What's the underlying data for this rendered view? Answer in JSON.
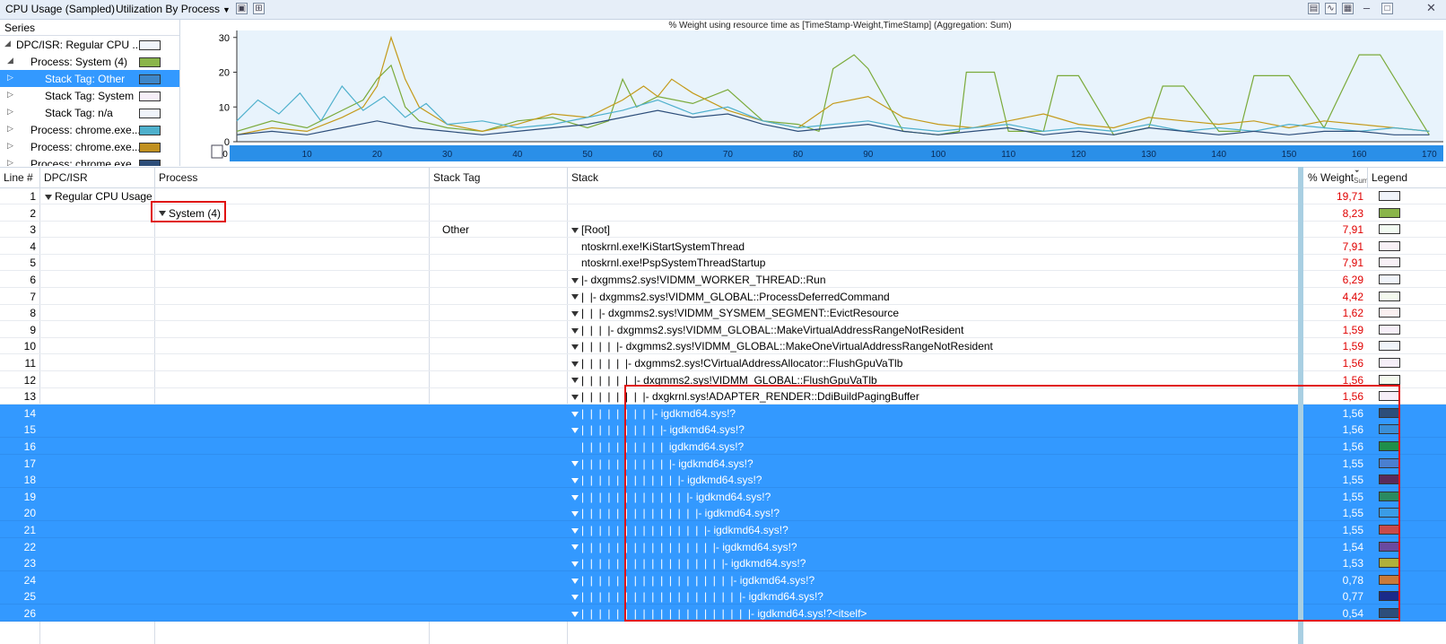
{
  "titlebar": {
    "title": "CPU Usage (Sampled)",
    "preset": "Utilization By Process",
    "icons": [
      "graph-only-icon",
      "graph-table-icon",
      "table-only-icon",
      "minimize-icon",
      "close-icon"
    ]
  },
  "series": {
    "header": "Series",
    "items": [
      {
        "label": "DPC/ISR: Regular CPU ...",
        "expander": "expanded",
        "indent": 0,
        "color": "#f0f4fa",
        "selected": false
      },
      {
        "label": "Process: System (4)",
        "expander": "expanded",
        "indent": 1,
        "color": "#8ab54a",
        "selected": false
      },
      {
        "label": "Stack Tag: Other",
        "expander": "collapsed",
        "indent": 2,
        "color": "#3e86c8",
        "selected": true
      },
      {
        "label": "Stack Tag: System",
        "expander": "collapsed",
        "indent": 2,
        "color": "#f6eef8",
        "selected": false
      },
      {
        "label": "Stack Tag: n/a",
        "expander": "collapsed",
        "indent": 2,
        "color": "#f0f4fa",
        "selected": false
      },
      {
        "label": "Process: chrome.exe...",
        "expander": "collapsed",
        "indent": 1,
        "color": "#4eb0cc",
        "selected": false
      },
      {
        "label": "Process: chrome.exe...",
        "expander": "collapsed",
        "indent": 1,
        "color": "#c09020",
        "selected": false
      },
      {
        "label": "Process: chrome.exe",
        "expander": "collapsed",
        "indent": 1,
        "color": "#2d4e7a",
        "selected": false
      }
    ]
  },
  "chart_data": {
    "type": "line",
    "title": "% Weight using resource time as [TimeStamp-Weight,TimeStamp] (Aggregation: Sum)",
    "xlim": [
      0,
      172
    ],
    "ylim": [
      0,
      32
    ],
    "xticks": [
      "0",
      "10",
      "20",
      "30",
      "40",
      "50",
      "60",
      "70",
      "80",
      "90",
      "100",
      "110",
      "120",
      "130",
      "140",
      "150",
      "160",
      "170"
    ],
    "yticks": [
      "0",
      "10",
      "20",
      "30"
    ],
    "grid": false,
    "series": [
      {
        "color": "#7aaa3a",
        "x": [
          0,
          5,
          10,
          15,
          18,
          20,
          22,
          24,
          26,
          30,
          35,
          40,
          45,
          50,
          53,
          55,
          57,
          60,
          65,
          70,
          75,
          80,
          83,
          85,
          88,
          90,
          95,
          100,
          103,
          104,
          108,
          110,
          115,
          117,
          120,
          125,
          130,
          132,
          135,
          140,
          143,
          145,
          150,
          155,
          160,
          161,
          163,
          170
        ],
        "y": [
          3,
          6,
          4,
          9,
          12,
          18,
          22,
          10,
          6,
          4,
          3,
          6,
          7,
          4,
          6,
          18,
          10,
          13,
          11,
          15,
          6,
          5,
          3,
          21,
          25,
          21,
          3,
          2,
          3,
          20,
          20,
          3,
          3,
          19,
          19,
          2,
          4,
          16,
          16,
          3,
          3,
          19,
          19,
          4,
          25,
          25,
          25,
          2
        ]
      },
      {
        "color": "#c49a1a",
        "x": [
          0,
          5,
          10,
          15,
          18,
          20,
          22,
          23,
          24,
          26,
          30,
          35,
          40,
          45,
          50,
          55,
          58,
          60,
          62,
          65,
          70,
          75,
          80,
          85,
          90,
          95,
          100,
          105,
          110,
          115,
          120,
          125,
          130,
          135,
          140,
          145,
          150,
          155,
          160,
          165,
          170
        ],
        "y": [
          2,
          4,
          3,
          7,
          10,
          16,
          30,
          24,
          18,
          10,
          5,
          3,
          5,
          8,
          7,
          12,
          16,
          13,
          18,
          14,
          9,
          6,
          4,
          11,
          13,
          7,
          5,
          4,
          6,
          8,
          5,
          4,
          7,
          6,
          5,
          6,
          4,
          6,
          5,
          4,
          3
        ]
      },
      {
        "color": "#4eb0cc",
        "x": [
          0,
          3,
          6,
          9,
          12,
          15,
          18,
          21,
          24,
          27,
          30,
          35,
          40,
          45,
          50,
          55,
          60,
          65,
          70,
          75,
          80,
          85,
          90,
          95,
          100,
          105,
          110,
          115,
          120,
          125,
          130,
          135,
          140,
          145,
          150,
          155,
          160,
          165,
          170
        ],
        "y": [
          6,
          12,
          8,
          14,
          6,
          16,
          9,
          13,
          7,
          11,
          5,
          6,
          4,
          5,
          7,
          9,
          12,
          8,
          10,
          6,
          4,
          5,
          6,
          4,
          3,
          4,
          5,
          3,
          4,
          3,
          5,
          3,
          4,
          3,
          5,
          4,
          3,
          4,
          3
        ]
      },
      {
        "color": "#2d4e7a",
        "x": [
          0,
          5,
          10,
          15,
          20,
          25,
          30,
          35,
          40,
          45,
          50,
          55,
          60,
          65,
          70,
          75,
          80,
          85,
          90,
          95,
          100,
          105,
          110,
          115,
          120,
          125,
          130,
          135,
          140,
          145,
          150,
          155,
          160,
          165,
          170
        ],
        "y": [
          2,
          3,
          2,
          4,
          6,
          4,
          3,
          2,
          3,
          4,
          5,
          7,
          9,
          7,
          8,
          5,
          3,
          4,
          5,
          3,
          2,
          3,
          4,
          2,
          3,
          2,
          4,
          3,
          2,
          3,
          2,
          3,
          3,
          2,
          2
        ]
      }
    ]
  },
  "table": {
    "columns": [
      "Line #",
      "DPC/ISR",
      "Process",
      "Stack Tag",
      "Stack",
      "% Weight",
      "Legend"
    ],
    "sum_label": "Sum",
    "rows": [
      {
        "line": "1",
        "dpc": "Regular CPU Usage",
        "dpc_expander": true,
        "process": "",
        "process_expander": false,
        "tag": "",
        "stack": "",
        "stack_expander": false,
        "weight": "19,71",
        "legend": "#f0f4fa",
        "selected": false
      },
      {
        "line": "2",
        "dpc": "",
        "dpc_expander": false,
        "process": "System (4)",
        "process_expander": true,
        "tag": "",
        "stack": "",
        "stack_expander": false,
        "weight": "8,23",
        "legend": "#8ab54a",
        "selected": false
      },
      {
        "line": "3",
        "dpc": "",
        "dpc_expander": false,
        "process": "",
        "process_expander": false,
        "tag": "Other",
        "stack": "[Root]",
        "stack_expander": true,
        "weight": "7,91",
        "legend": "#f2fbf2",
        "selected": false
      },
      {
        "line": "4",
        "dpc": "",
        "dpc_expander": false,
        "process": "",
        "process_expander": false,
        "tag": "",
        "stack": "ntoskrnl.exe!KiStartSystemThread",
        "stack_expander": false,
        "weight": "7,91",
        "legend": "#f8f0f6",
        "selected": false
      },
      {
        "line": "5",
        "dpc": "",
        "dpc_expander": false,
        "process": "",
        "process_expander": false,
        "tag": "",
        "stack": "ntoskrnl.exe!PspSystemThreadStartup",
        "stack_expander": false,
        "weight": "7,91",
        "legend": "#f8f0f6",
        "selected": false
      },
      {
        "line": "6",
        "dpc": "",
        "dpc_expander": false,
        "process": "",
        "process_expander": false,
        "tag": "",
        "stack": "|- dxgmms2.sys!VIDMM_WORKER_THREAD::Run",
        "stack_expander": true,
        "weight": "6,29",
        "legend": "#f0f4fa",
        "selected": false
      },
      {
        "line": "7",
        "dpc": "",
        "dpc_expander": false,
        "process": "",
        "process_expander": false,
        "tag": "",
        "stack": "|  |- dxgmms2.sys!VIDMM_GLOBAL::ProcessDeferredCommand",
        "stack_expander": true,
        "weight": "4,42",
        "legend": "#f4f9ee",
        "selected": false
      },
      {
        "line": "8",
        "dpc": "",
        "dpc_expander": false,
        "process": "",
        "process_expander": false,
        "tag": "",
        "stack": "|  |  |- dxgmms2.sys!VIDMM_SYSMEM_SEGMENT::EvictResource",
        "stack_expander": true,
        "weight": "1,62",
        "legend": "#fbf0f0",
        "selected": false
      },
      {
        "line": "9",
        "dpc": "",
        "dpc_expander": false,
        "process": "",
        "process_expander": false,
        "tag": "",
        "stack": "|  |  |  |- dxgmms2.sys!VIDMM_GLOBAL::MakeVirtualAddressRangeNotResident",
        "stack_expander": true,
        "weight": "1,59",
        "legend": "#f6eef8",
        "selected": false
      },
      {
        "line": "10",
        "dpc": "",
        "dpc_expander": false,
        "process": "",
        "process_expander": false,
        "tag": "",
        "stack": "|  |  |  |  |- dxgmms2.sys!VIDMM_GLOBAL::MakeOneVirtualAddressRangeNotResident",
        "stack_expander": true,
        "weight": "1,59",
        "legend": "#f0f4fa",
        "selected": false
      },
      {
        "line": "11",
        "dpc": "",
        "dpc_expander": false,
        "process": "",
        "process_expander": false,
        "tag": "",
        "stack": "|  |  |  |  |  |- dxgmms2.sys!CVirtualAddressAllocator::FlushGpuVaTlb",
        "stack_expander": true,
        "weight": "1,56",
        "legend": "#f6eef8",
        "selected": false
      },
      {
        "line": "12",
        "dpc": "",
        "dpc_expander": false,
        "process": "",
        "process_expander": false,
        "tag": "",
        "stack": "|  |  |  |  |  |  |- dxgmms2.sys!VIDMM_GLOBAL::FlushGpuVaTlb",
        "stack_expander": true,
        "weight": "1,56",
        "legend": "#f4f9ee",
        "selected": false
      },
      {
        "line": "13",
        "dpc": "",
        "dpc_expander": false,
        "process": "",
        "process_expander": false,
        "tag": "",
        "stack": "|  |  |  |  |  |  |  |- dxgkrnl.sys!ADAPTER_RENDER::DdiBuildPagingBuffer",
        "stack_expander": true,
        "weight": "1,56",
        "legend": "#f6eef8",
        "selected": false
      },
      {
        "line": "14",
        "dpc": "",
        "dpc_expander": false,
        "process": "",
        "process_expander": false,
        "tag": "",
        "stack": "|  |  |  |  |  |  |  |  |- igdkmd64.sys!?",
        "stack_expander": true,
        "weight": "1,56",
        "legend": "#2d4e7a",
        "selected": true
      },
      {
        "line": "15",
        "dpc": "",
        "dpc_expander": false,
        "process": "",
        "process_expander": false,
        "tag": "",
        "stack": "|  |  |  |  |  |  |  |  |  |- igdkmd64.sys!?",
        "stack_expander": true,
        "weight": "1,56",
        "legend": "#3a8fd9",
        "selected": true
      },
      {
        "line": "16",
        "dpc": "",
        "dpc_expander": false,
        "process": "",
        "process_expander": false,
        "tag": "",
        "stack": "|  |  |  |  |  |  |  |  |  |  igdkmd64.sys!?",
        "stack_expander": false,
        "weight": "1,56",
        "legend": "#1f8f4a",
        "selected": true
      },
      {
        "line": "17",
        "dpc": "",
        "dpc_expander": false,
        "process": "",
        "process_expander": false,
        "tag": "",
        "stack": "|  |  |  |  |  |  |  |  |  |  |- igdkmd64.sys!?",
        "stack_expander": true,
        "weight": "1,55",
        "legend": "#4a7fd0",
        "selected": true
      },
      {
        "line": "18",
        "dpc": "",
        "dpc_expander": false,
        "process": "",
        "process_expander": false,
        "tag": "",
        "stack": "|  |  |  |  |  |  |  |  |  |  |  |- igdkmd64.sys!?",
        "stack_expander": true,
        "weight": "1,55",
        "legend": "#5a2a5a",
        "selected": true
      },
      {
        "line": "19",
        "dpc": "",
        "dpc_expander": false,
        "process": "",
        "process_expander": false,
        "tag": "",
        "stack": "|  |  |  |  |  |  |  |  |  |  |  |  |- igdkmd64.sys!?",
        "stack_expander": true,
        "weight": "1,55",
        "legend": "#2a8a60",
        "selected": true
      },
      {
        "line": "20",
        "dpc": "",
        "dpc_expander": false,
        "process": "",
        "process_expander": false,
        "tag": "",
        "stack": "|  |  |  |  |  |  |  |  |  |  |  |  |  |- igdkmd64.sys!?",
        "stack_expander": true,
        "weight": "1,55",
        "legend": "#3a9ce6",
        "selected": true
      },
      {
        "line": "21",
        "dpc": "",
        "dpc_expander": false,
        "process": "",
        "process_expander": false,
        "tag": "",
        "stack": "|  |  |  |  |  |  |  |  |  |  |  |  |  |  |- igdkmd64.sys!?",
        "stack_expander": true,
        "weight": "1,55",
        "legend": "#c84a4a",
        "selected": true
      },
      {
        "line": "22",
        "dpc": "",
        "dpc_expander": false,
        "process": "",
        "process_expander": false,
        "tag": "",
        "stack": "|  |  |  |  |  |  |  |  |  |  |  |  |  |  |  |- igdkmd64.sys!?",
        "stack_expander": true,
        "weight": "1,54",
        "legend": "#6a4aa0",
        "selected": true
      },
      {
        "line": "23",
        "dpc": "",
        "dpc_expander": false,
        "process": "",
        "process_expander": false,
        "tag": "",
        "stack": "|  |  |  |  |  |  |  |  |  |  |  |  |  |  |  |  |- igdkmd64.sys!?",
        "stack_expander": true,
        "weight": "1,53",
        "legend": "#b0b03a",
        "selected": true
      },
      {
        "line": "24",
        "dpc": "",
        "dpc_expander": false,
        "process": "",
        "process_expander": false,
        "tag": "",
        "stack": "|  |  |  |  |  |  |  |  |  |  |  |  |  |  |  |  |  |- igdkmd64.sys!?",
        "stack_expander": true,
        "weight": "0,78",
        "legend": "#c87a3a",
        "selected": true
      },
      {
        "line": "25",
        "dpc": "",
        "dpc_expander": false,
        "process": "",
        "process_expander": false,
        "tag": "",
        "stack": "|  |  |  |  |  |  |  |  |  |  |  |  |  |  |  |  |  |  |- igdkmd64.sys!?",
        "stack_expander": true,
        "weight": "0,77",
        "legend": "#1a2a8a",
        "selected": true
      },
      {
        "line": "26",
        "dpc": "",
        "dpc_expander": false,
        "process": "",
        "process_expander": false,
        "tag": "",
        "stack": "|  |  |  |  |  |  |  |  |  |  |  |  |  |  |  |  |  |  |  |- igdkmd64.sys!?<itself>",
        "stack_expander": true,
        "weight": "0,54",
        "legend": "#2d4e7a",
        "selected": true
      }
    ]
  }
}
